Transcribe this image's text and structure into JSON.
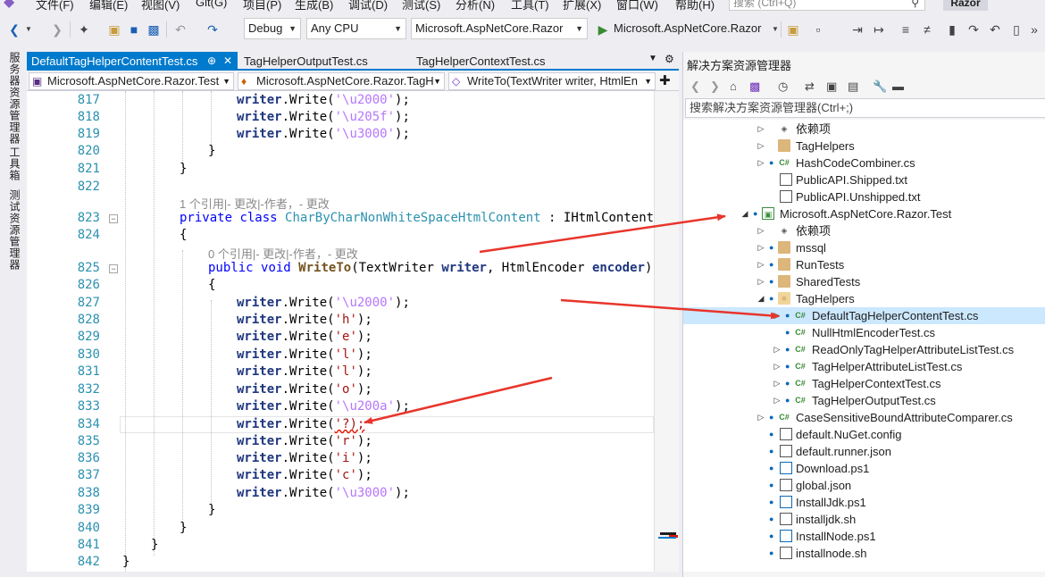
{
  "menu": {
    "items": [
      "文件(F)",
      "编辑(E)",
      "视图(V)",
      "Git(G)",
      "项目(P)",
      "生成(B)",
      "调试(D)",
      "测试(S)",
      "分析(N)",
      "工具(T)",
      "扩展(X)",
      "窗口(W)",
      "帮助(H)"
    ],
    "search_placeholder": "搜索 (Ctrl+Q)",
    "solution_name": "Razor"
  },
  "toolbar": {
    "config": "Debug",
    "platform": "Any CPU",
    "startup_project": "Microsoft.AspNetCore.Razor",
    "run_label": "Microsoft.AspNetCore.Razor"
  },
  "left_strip": [
    "服务器资源管理器",
    "工具箱",
    "测试资源管理器"
  ],
  "editor_tabs": [
    {
      "label": "DefaultTagHelperContentTest.cs",
      "active": true
    },
    {
      "label": "TagHelperOutputTest.cs",
      "active": false
    },
    {
      "label": "TagHelperContextTest.cs",
      "active": false
    }
  ],
  "navbar": {
    "project": "Microsoft.AspNetCore.Razor.Test",
    "type": "Microsoft.AspNetCore.Razor.TagH",
    "member": "WriteTo(TextWriter writer, HtmlEn"
  },
  "code_lens": {
    "class_lens": "1 个引用|- 更改|-作者，- 更改",
    "method_lens": "0 个引用|- 更改|-作者，- 更改"
  },
  "line_numbers": [
    "817",
    "818",
    "819",
    "820",
    "821",
    "822",
    "823",
    "824",
    "825",
    "826",
    "827",
    "828",
    "829",
    "830",
    "831",
    "832",
    "833",
    "834",
    "835",
    "836",
    "837",
    "838",
    "839",
    "840",
    "841",
    "842"
  ],
  "code": {
    "writer": "writer",
    "write": ".Write(",
    "close": ");",
    "u2000": "'\\u2000'",
    "u205f": "'\\u205f'",
    "u3000": "'\\u3000'",
    "u200a": "'\\u200a'",
    "h": "'h'",
    "e": "'e'",
    "l": "'l'",
    "o": "'o'",
    "q": "'?);",
    "r": "'r'",
    "i": "'i'",
    "c": "'c'",
    "brace_close": "}",
    "brace_open": "{",
    "private": "private",
    "class": "class",
    "class_name": "CharByCharNonWhiteSpaceHtmlContent",
    "colon": " : ",
    "iface": "IHtmlContent",
    "public": "public",
    "void": "void",
    "method": "WriteTo",
    "paren_open": "(",
    "t_writer": "TextWriter",
    "p_writer": "writer",
    "comma": ", ",
    "t_encoder": "HtmlEncoder",
    "p_encoder": "encoder",
    "paren_close": ")"
  },
  "solution_explorer": {
    "title": "解决方案资源管理器",
    "search_placeholder": "搜索解决方案资源管理器(Ctrl+;)",
    "tree": [
      {
        "label": "依赖项",
        "icon": "dependencies-icon"
      },
      {
        "label": "TagHelpers",
        "icon": "folder-icon"
      },
      {
        "label": "HashCodeCombiner.cs",
        "icon": "csharp-file-icon"
      },
      {
        "label": "PublicAPI.Shipped.txt",
        "icon": "text-file-icon"
      },
      {
        "label": "PublicAPI.Unshipped.txt",
        "icon": "text-file-icon"
      },
      {
        "label": "Microsoft.AspNetCore.Razor.Test",
        "icon": "project-icon"
      },
      {
        "label": "依赖项",
        "icon": "dependencies-icon"
      },
      {
        "label": "mssql",
        "icon": "folder-icon"
      },
      {
        "label": "RunTests",
        "icon": "folder-icon"
      },
      {
        "label": "SharedTests",
        "icon": "folder-icon"
      },
      {
        "label": "TagHelpers",
        "icon": "folder-open-icon"
      },
      {
        "label": "DefaultTagHelperContentTest.cs",
        "icon": "csharp-file-icon"
      },
      {
        "label": "NullHtmlEncoderTest.cs",
        "icon": "csharp-file-icon"
      },
      {
        "label": "ReadOnlyTagHelperAttributeListTest.cs",
        "icon": "csharp-file-icon"
      },
      {
        "label": "TagHelperAttributeListTest.cs",
        "icon": "csharp-file-icon"
      },
      {
        "label": "TagHelperContextTest.cs",
        "icon": "csharp-file-icon"
      },
      {
        "label": "TagHelperOutputTest.cs",
        "icon": "csharp-file-icon"
      },
      {
        "label": "CaseSensitiveBoundAttributeComparer.cs",
        "icon": "csharp-file-icon"
      },
      {
        "label": "default.NuGet.config",
        "icon": "config-file-icon"
      },
      {
        "label": "default.runner.json",
        "icon": "json-file-icon"
      },
      {
        "label": "Download.ps1",
        "icon": "powershell-file-icon"
      },
      {
        "label": "global.json",
        "icon": "json-file-icon"
      },
      {
        "label": "InstallJdk.ps1",
        "icon": "powershell-file-icon"
      },
      {
        "label": "installjdk.sh",
        "icon": "shell-file-icon"
      },
      {
        "label": "InstallNode.ps1",
        "icon": "powershell-file-icon"
      },
      {
        "label": "installnode.sh",
        "icon": "shell-file-icon"
      }
    ]
  },
  "colors": {
    "accent": "#007acc",
    "annotation_arrow": "#e8352b",
    "selected_row": "#cce8ff"
  }
}
